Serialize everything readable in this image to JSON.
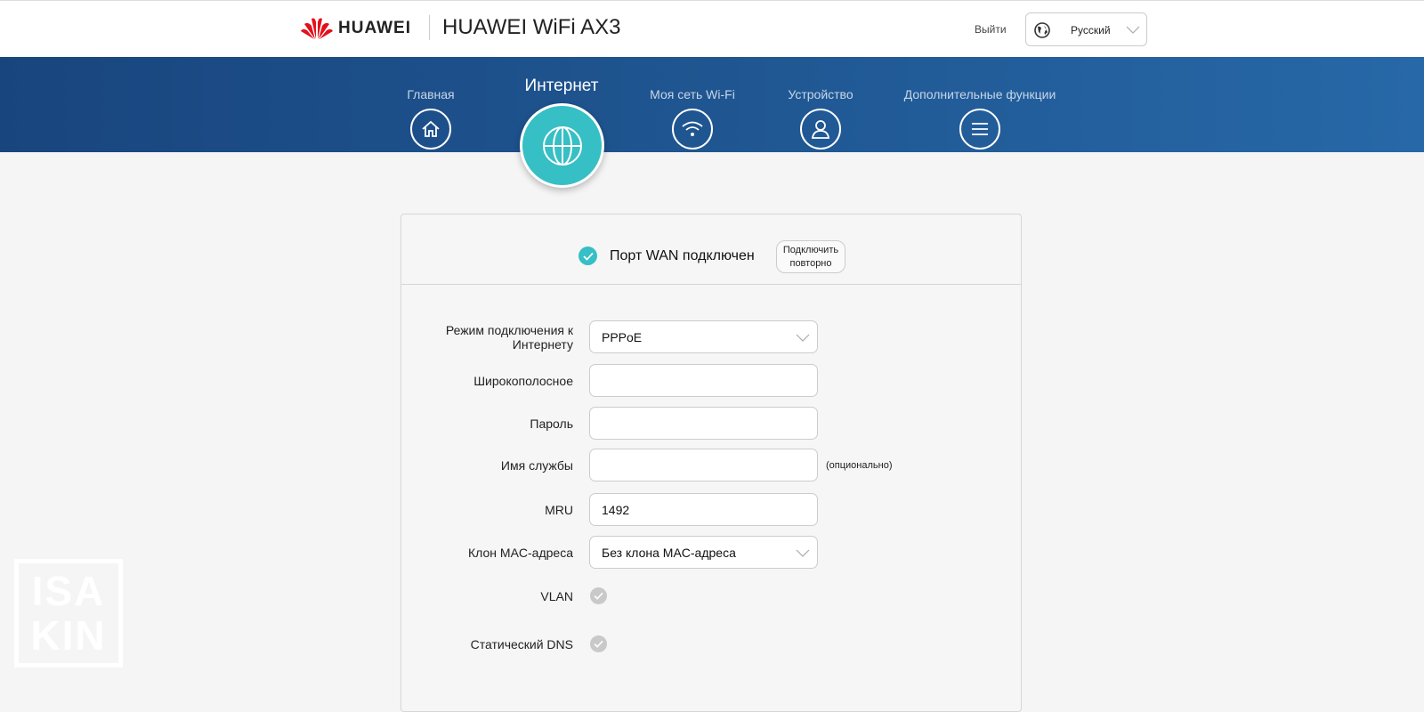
{
  "header": {
    "brand": "HUAWEI",
    "title": "HUAWEI WiFi AX3",
    "logout": "Выйти",
    "language": "Русский"
  },
  "nav": [
    {
      "label": "Главная",
      "icon": "home-icon"
    },
    {
      "label": "Интернет",
      "icon": "globe-icon",
      "active": true
    },
    {
      "label": "Моя сеть Wi-Fi",
      "icon": "wifi-icon"
    },
    {
      "label": "Устройство",
      "icon": "user-icon"
    },
    {
      "label": "Дополнительные функции",
      "icon": "menu-icon"
    }
  ],
  "status": {
    "text": "Порт WAN подключен",
    "reconnect": "Подключить повторно"
  },
  "form": {
    "mode_label": "Режим подключения к Интернету",
    "mode_value": "PPPoE",
    "broadband_label": "Широкополосное",
    "broadband_value": "",
    "password_label": "Пароль",
    "password_value": "",
    "service_label": "Имя службы",
    "service_value": "",
    "service_note": "(опционально)",
    "mru_label": "MRU",
    "mru_value": "1492",
    "mac_label": "Клон MAC-адреса",
    "mac_value": "Без клона MAC-адреса",
    "vlan_label": "VLAN",
    "vlan_enabled": false,
    "dns_label": "Статический DNS",
    "dns_enabled": false
  },
  "watermark": {
    "line1": "ISA",
    "line2": "KIN"
  },
  "colors": {
    "accent": "#36bfc4",
    "band": "#1f5691"
  }
}
